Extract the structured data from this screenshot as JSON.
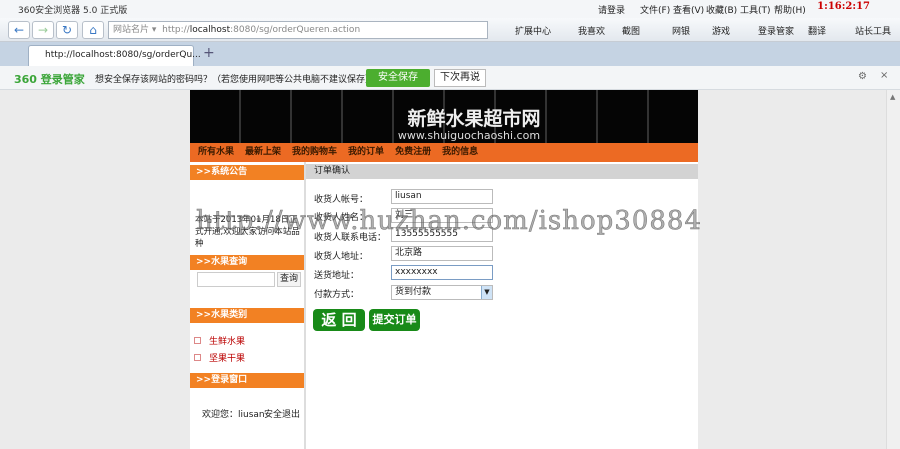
{
  "browser": {
    "title": "360安全浏览器 5.0 正式版",
    "login": "请登录",
    "menus": [
      "文件(F)",
      "查看(V)",
      "收藏(B)",
      "工具(T)",
      "帮助(H)"
    ],
    "clock": "1:16:2:17",
    "address_label": "网站名片",
    "url_prefix": "http://",
    "url_host": "localhost",
    "url_rest": ":8080/sg/orderQueren.action",
    "tools": [
      "扩展中心",
      "我喜欢",
      "截图",
      "网银",
      "游戏",
      "登录管家",
      "翻译",
      "站长工具"
    ],
    "tab_title": "http://localhost:8080/sg/orderQu...",
    "pw_logo": "360 登录管家",
    "pw_message": "想安全保存该网站的密码吗？（若您使用网吧等公共电脑不建议保存）",
    "pw_save": "安全保存",
    "pw_later": "下次再说"
  },
  "site": {
    "title": "新鲜水果超市网",
    "url": "www.shuiguochaoshi.com",
    "nav": [
      "所有水果",
      "最新上架",
      "我的购物车",
      "我的订单",
      "免费注册",
      "我的信息"
    ],
    "sidebar": {
      "notice_title": ">>系统公告",
      "notice_text": "本站于2013年01月18日正式开通,欢迎大家访问本站品种",
      "search_title": ">>水果查询",
      "search_button": "查询",
      "category_title": ">>水果类别",
      "categories": [
        "生鲜水果",
        "坚果干果"
      ],
      "login_title": ">>登录窗口",
      "welcome": "欢迎您：liusan",
      "logout": "安全退出"
    },
    "order": {
      "title": "订单确认",
      "fields": [
        {
          "label": "收货人帐号：",
          "value": "liusan"
        },
        {
          "label": "收货人姓名：",
          "value": "刘三"
        },
        {
          "label": "收货人联系电话：",
          "value": "13555555555"
        },
        {
          "label": "收货人地址：",
          "value": "北京路"
        },
        {
          "label": "送货地址：",
          "value": "xxxxxxxx"
        }
      ],
      "payment_label": "付款方式：",
      "payment_value": "货到付款",
      "back": "返 回",
      "submit": "提交订单"
    }
  },
  "watermark": "http://www.huzhan.com/ishop30884"
}
